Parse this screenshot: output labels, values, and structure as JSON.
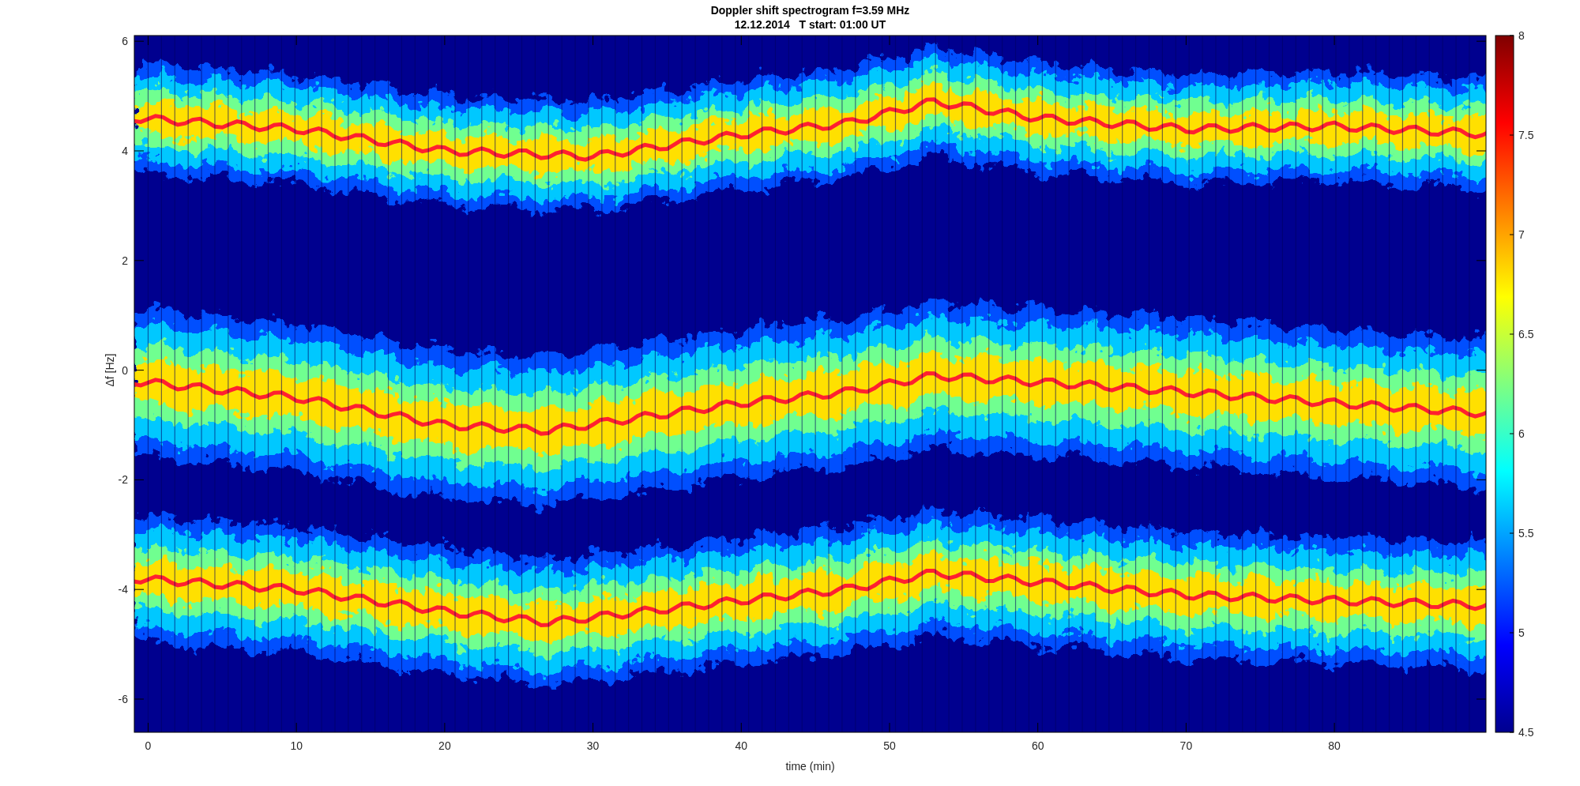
{
  "figure": {
    "title": "Doppler shift spectrogram f=3.59 MHz",
    "subtitle": "12.12.2014   T start: 01:00 UT"
  },
  "axes": {
    "xlabel": "time (min)",
    "ylabel": "Δf [Hz]",
    "xticks": [
      "0",
      "10",
      "20",
      "30",
      "40",
      "50",
      "60",
      "70",
      "80"
    ],
    "yticks": [
      "6",
      "4",
      "2",
      "0",
      "-2",
      "-4",
      "-6"
    ]
  },
  "colorbar": {
    "ticks": [
      "8",
      "7.5",
      "7",
      "6.5",
      "6",
      "5.5",
      "5",
      "4.5"
    ]
  }
}
